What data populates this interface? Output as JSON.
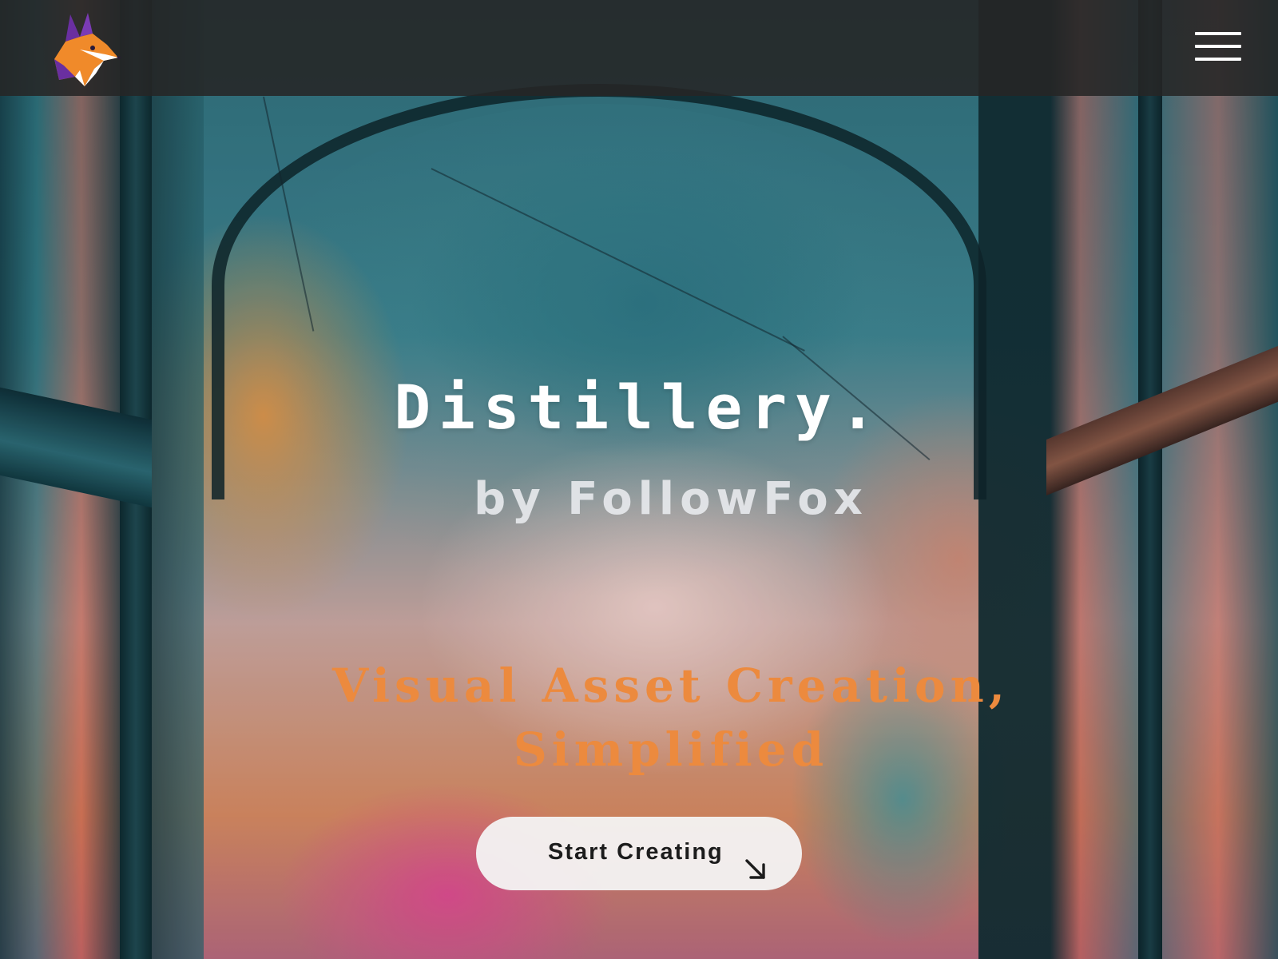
{
  "header": {
    "logo_icon": "fox-head-logo-icon",
    "menu_icon": "hamburger-menu-icon"
  },
  "hero": {
    "title": "Distillery.",
    "byline": "by FollowFox",
    "tagline_line1": "Visual Asset Creation,",
    "tagline_line2": "Simplified",
    "cta_label": "Start Creating",
    "cta_icon": "arrow-down-right-icon"
  },
  "colors": {
    "header_bg": "#262626",
    "tagline": "#ec8a3e",
    "cta_bg": "#f4f4f4",
    "cta_text": "#1c1c1c",
    "fox_orange": "#f08a2a",
    "fox_purple": "#6a2fa0"
  }
}
